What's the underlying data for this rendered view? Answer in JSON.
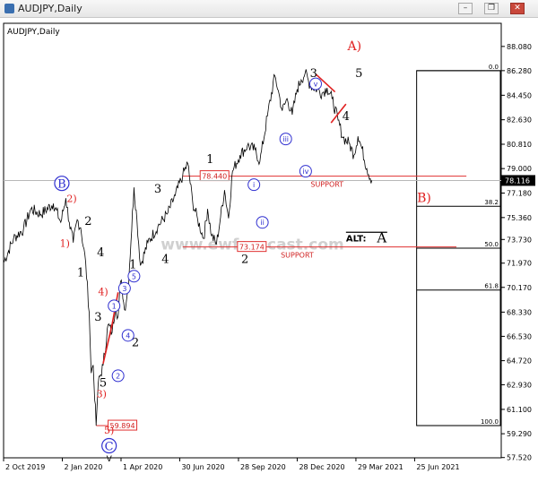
{
  "window": {
    "title": "AUDJPY,Daily",
    "minimize": "–",
    "restore": "❐",
    "close": "✕",
    "icon": "chart-window-icon"
  },
  "chart_data": {
    "type": "line",
    "symbol_label": "AUDJPY,Daily",
    "ylim": [
      57.5,
      89.8
    ],
    "y_ticks": [
      "88.080",
      "86.280",
      "84.450",
      "82.630",
      "80.810",
      "79.000",
      "77.180",
      "75.360",
      "73.730",
      "71.970",
      "70.170",
      "68.330",
      "66.530",
      "64.720",
      "62.930",
      "61.100",
      "59.290",
      "57.520"
    ],
    "y_tick_values": [
      88.08,
      86.28,
      84.45,
      82.63,
      80.81,
      79.0,
      77.18,
      75.36,
      73.73,
      71.97,
      70.17,
      68.33,
      66.53,
      64.72,
      62.93,
      61.1,
      59.29,
      57.52
    ],
    "x_ticks": [
      "2 Oct 2019",
      "2 Jan 2020",
      "1 Apr 2020",
      "30 Jun 2020",
      "28 Sep 2020",
      "28 Dec 2020",
      "29 Mar 2021",
      "25 Jun 2021"
    ],
    "x_tick_pos": [
      0.0,
      0.118,
      0.236,
      0.354,
      0.472,
      0.59,
      0.708,
      0.826
    ],
    "current_price": "78.116",
    "current_price_value": 78.116,
    "series": [
      {
        "values": [
          [
            0.0,
            72.0
          ],
          [
            0.02,
            73.8
          ],
          [
            0.04,
            74.5
          ],
          [
            0.055,
            76.0
          ],
          [
            0.075,
            75.6
          ],
          [
            0.1,
            76.4
          ],
          [
            0.115,
            75.0
          ],
          [
            0.125,
            76.8
          ],
          [
            0.132,
            75.0
          ],
          [
            0.14,
            73.5
          ],
          [
            0.148,
            75.2
          ],
          [
            0.155,
            74.6
          ],
          [
            0.165,
            72.0
          ],
          [
            0.172,
            68.3
          ],
          [
            0.176,
            63.8
          ],
          [
            0.18,
            64.4
          ],
          [
            0.186,
            59.9
          ],
          [
            0.19,
            63.0
          ],
          [
            0.2,
            64.4
          ],
          [
            0.21,
            67.4
          ],
          [
            0.218,
            66.8
          ],
          [
            0.225,
            68.8
          ],
          [
            0.23,
            68.0
          ],
          [
            0.235,
            70.6
          ],
          [
            0.238,
            70.2
          ],
          [
            0.243,
            68.5
          ],
          [
            0.25,
            70.0
          ],
          [
            0.256,
            73.6
          ],
          [
            0.262,
            77.6
          ],
          [
            0.268,
            75.2
          ],
          [
            0.275,
            71.8
          ],
          [
            0.29,
            73.5
          ],
          [
            0.31,
            74.7
          ],
          [
            0.33,
            75.7
          ],
          [
            0.345,
            77.0
          ],
          [
            0.36,
            78.5
          ],
          [
            0.37,
            79.4
          ],
          [
            0.38,
            76.5
          ],
          [
            0.39,
            75.2
          ],
          [
            0.402,
            73.8
          ],
          [
            0.41,
            76.0
          ],
          [
            0.418,
            74.0
          ],
          [
            0.428,
            73.4
          ],
          [
            0.436,
            75.4
          ],
          [
            0.444,
            77.4
          ],
          [
            0.452,
            75.3
          ],
          [
            0.46,
            78.8
          ],
          [
            0.475,
            80.0
          ],
          [
            0.49,
            80.7
          ],
          [
            0.505,
            80.4
          ],
          [
            0.515,
            79.5
          ],
          [
            0.53,
            82.9
          ],
          [
            0.545,
            85.9
          ],
          [
            0.552,
            84.8
          ],
          [
            0.56,
            83.3
          ],
          [
            0.57,
            84.2
          ],
          [
            0.58,
            83.0
          ],
          [
            0.59,
            84.9
          ],
          [
            0.598,
            85.6
          ],
          [
            0.606,
            86.1
          ],
          [
            0.616,
            85.2
          ],
          [
            0.63,
            84.9
          ],
          [
            0.64,
            84.6
          ],
          [
            0.65,
            85.0
          ],
          [
            0.66,
            84.2
          ],
          [
            0.672,
            82.6
          ],
          [
            0.682,
            81.3
          ],
          [
            0.694,
            80.9
          ],
          [
            0.704,
            80.0
          ],
          [
            0.712,
            81.4
          ],
          [
            0.72,
            80.5
          ],
          [
            0.73,
            79.0
          ],
          [
            0.74,
            78.116
          ]
        ]
      }
    ],
    "support_lines": [
      {
        "value": 78.44,
        "label": "78.440",
        "note": "SUPPORT"
      },
      {
        "value": 73.174,
        "label": "73.174",
        "note": "SUPPORT"
      }
    ],
    "low_level": {
      "value": 59.894,
      "label": "59.894"
    },
    "fib": {
      "levels": [
        "0.0",
        "38.2",
        "50.0",
        "61.8",
        "100.0"
      ],
      "values": [
        0.0,
        38.2,
        50.0,
        61.8,
        100.0
      ]
    },
    "alt_label": "ALT:",
    "alt_wave": "A",
    "watermark": "www.ewforecast.com",
    "waves": {
      "black": [
        {
          "t": "1",
          "x": 0.155,
          "y": 71.0
        },
        {
          "t": "2",
          "x": 0.17,
          "y": 74.8
        },
        {
          "t": "3",
          "x": 0.19,
          "y": 67.7
        },
        {
          "t": "4",
          "x": 0.195,
          "y": 72.5
        },
        {
          "t": "5",
          "x": 0.2,
          "y": 62.8
        },
        {
          "t": "1",
          "x": 0.26,
          "y": 71.6
        },
        {
          "t": "2",
          "x": 0.265,
          "y": 65.8
        },
        {
          "t": "3",
          "x": 0.31,
          "y": 77.2
        },
        {
          "t": "4",
          "x": 0.325,
          "y": 72.0
        },
        {
          "t": "1",
          "x": 0.415,
          "y": 79.4
        },
        {
          "t": "2",
          "x": 0.485,
          "y": 72.0
        },
        {
          "t": "3",
          "x": 0.623,
          "y": 85.8
        },
        {
          "t": "4",
          "x": 0.688,
          "y": 82.6
        },
        {
          "t": "5",
          "x": 0.714,
          "y": 85.8
        }
      ],
      "red": [
        {
          "t": "2)",
          "x": 0.137,
          "y": 76.5
        },
        {
          "t": "1)",
          "x": 0.123,
          "y": 73.2
        },
        {
          "t": "4)",
          "x": 0.2,
          "y": 69.6
        },
        {
          "t": "3)",
          "x": 0.197,
          "y": 62.0
        },
        {
          "t": "5)",
          "x": 0.212,
          "y": 59.3
        },
        {
          "t": "A)",
          "x": 0.705,
          "y": 87.8
        },
        {
          "t": "B)",
          "x": 0.845,
          "y": 76.5
        }
      ],
      "blue_circle": [
        {
          "t": "1",
          "x": 0.222,
          "y": 68.8
        },
        {
          "t": "2",
          "x": 0.23,
          "y": 63.6
        },
        {
          "t": "3",
          "x": 0.243,
          "y": 70.1
        },
        {
          "t": "4",
          "x": 0.25,
          "y": 66.6
        },
        {
          "t": "5",
          "x": 0.262,
          "y": 71.0
        },
        {
          "t": "i",
          "x": 0.503,
          "y": 77.8
        },
        {
          "t": "ii",
          "x": 0.52,
          "y": 75.0
        },
        {
          "t": "iii",
          "x": 0.567,
          "y": 81.2
        },
        {
          "t": "iv",
          "x": 0.607,
          "y": 78.8
        },
        {
          "t": "v",
          "x": 0.627,
          "y": 85.3
        }
      ],
      "blue_big": [
        {
          "t": "B",
          "x": 0.117,
          "y": 77.9
        },
        {
          "t": "C",
          "x": 0.212,
          "y": 58.4
        }
      ]
    }
  }
}
